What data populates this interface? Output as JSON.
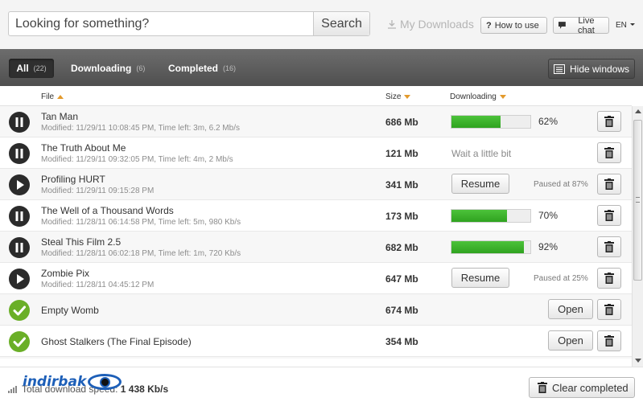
{
  "search": {
    "placeholder": "Looking for something?",
    "button": "Search"
  },
  "header": {
    "my_downloads": "My Downloads",
    "how_to_use": "How to use",
    "live_chat": "Live chat",
    "language": "EN"
  },
  "tabs": [
    {
      "label": "All",
      "count": "(22)"
    },
    {
      "label": "Downloading",
      "count": "(6)"
    },
    {
      "label": "Completed",
      "count": "(16)"
    }
  ],
  "hide_windows": "Hide windows",
  "columns": {
    "file": "File",
    "size": "Size",
    "downloading": "Downloading"
  },
  "rows": [
    {
      "icon": "pause",
      "name": "Tan Man",
      "meta": "Modified: 11/29/11 10:08:45 PM,  Time left: 3m,  6.2 Mb/s",
      "size": "686 Mb",
      "kind": "progress",
      "progress": 62,
      "pct_text": "62%"
    },
    {
      "icon": "pause",
      "name": "The Truth About Me",
      "meta": "Modified: 11/29/11 09:32:05 PM,  Time left: 4m,  2 Mb/s",
      "size": "121 Mb",
      "kind": "wait",
      "wait_text": "Wait a little bit"
    },
    {
      "icon": "play",
      "name": "Profiling HURT",
      "meta": "Modified: 11/29/11 09:15:28 PM",
      "size": "341 Mb",
      "kind": "paused",
      "resume": "Resume",
      "paused_text": "Paused at 87%"
    },
    {
      "icon": "pause",
      "name": "The Well of a Thousand Words",
      "meta": "Modified: 11/28/11 06:14:58 PM,  Time left: 5m,  980 Kb/s",
      "size": "173 Mb",
      "kind": "progress",
      "progress": 70,
      "pct_text": "70%"
    },
    {
      "icon": "pause",
      "name": "Steal This Film 2.5",
      "meta": "Modified: 11/28/11 06:02:18 PM,  Time left: 1m,  720 Kb/s",
      "size": "682 Mb",
      "kind": "progress",
      "progress": 92,
      "pct_text": "92%"
    },
    {
      "icon": "play",
      "name": "Zombie Pix",
      "meta": "Modified: 11/28/11 04:45:12 PM",
      "size": "647 Mb",
      "kind": "paused",
      "resume": "Resume",
      "paused_text": "Paused at 25%"
    },
    {
      "icon": "done",
      "name": "Empty Womb",
      "meta": "",
      "size": "674 Mb",
      "kind": "done",
      "open": "Open"
    },
    {
      "icon": "done",
      "name": "Ghost Stalkers (The Final Episode)",
      "meta": "",
      "size": "354 Mb",
      "kind": "done",
      "open": "Open"
    }
  ],
  "footer": {
    "total_label": "Total download speed:",
    "total_value": "1 438 Kb/s",
    "clear_completed": "Clear completed",
    "watermark": "indirbak"
  },
  "colors": {
    "progress": "#3bb32a",
    "done": "#6aaf27",
    "accent": "#e39a2c",
    "tabbar": "#5a5a5a"
  }
}
